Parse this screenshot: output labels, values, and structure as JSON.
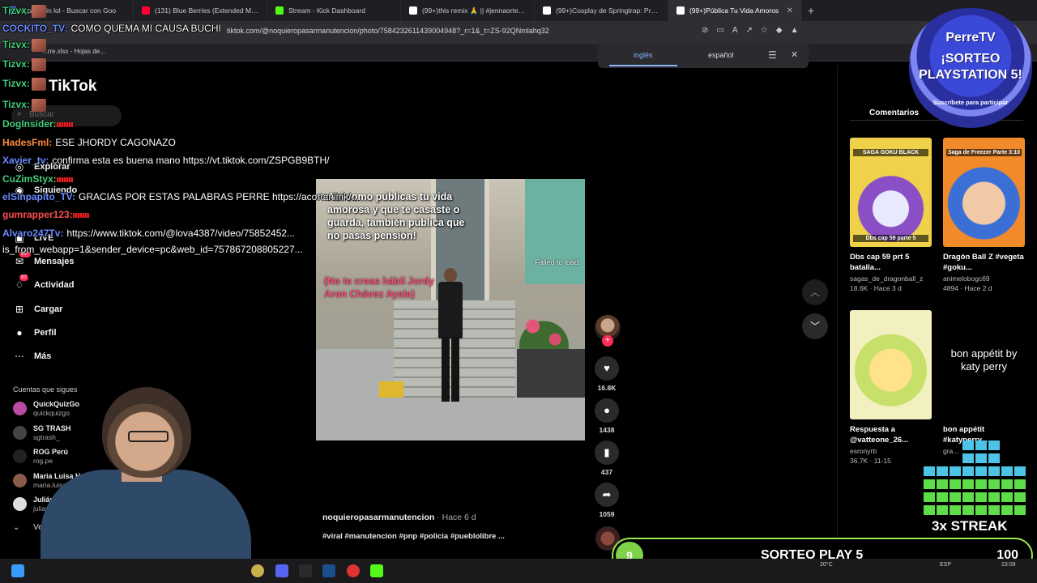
{
  "browser": {
    "tabs": [
      {
        "label": "tips to win lol - Buscar con Goo",
        "color": "#4285f4"
      },
      {
        "label": "(131) Blue Berries (Extended Mix) - Y",
        "color": "#ff0033"
      },
      {
        "label": "Stream - Kick Dashboard",
        "color": "#53fc18"
      },
      {
        "label": "(99+)this remix 🙏 || #jennaortega #j",
        "color": "#ffffff"
      },
      {
        "label": "(99+)Cosplay de Springtrap: Prueba",
        "color": "#ffffff"
      },
      {
        "label": "(99+)Pública Tu Vida Amoros",
        "color": "#ffffff"
      }
    ],
    "url": "tiktok.com/@noquieropasarmanutencion/photo/7584232611439004948?_r=1&_t=ZS-92QNmlahq32",
    "bookmark": "...rre.xlsx - Hojas de..."
  },
  "translate_bar": {
    "lang_from": "inglés",
    "lang_to": "español"
  },
  "tiktok": {
    "logo": "TikTok",
    "search_placeholder": "Buscar",
    "nav": [
      {
        "icon": "compass-icon",
        "label": "Explorar"
      },
      {
        "icon": "people-icon",
        "label": "Siguiendo"
      },
      {
        "icon": "live-icon",
        "label": "LIVE"
      },
      {
        "icon": "message-icon",
        "label": "Mensajes",
        "badge": "99+"
      },
      {
        "icon": "bell-icon",
        "label": "Actividad",
        "badge": "97"
      },
      {
        "icon": "upload-icon",
        "label": "Cargar"
      },
      {
        "icon": "profile-icon",
        "label": "Perfil"
      },
      {
        "icon": "more-icon",
        "label": "Más"
      }
    ],
    "following_header": "Cuentas que sigues",
    "following": [
      {
        "name": "QuickQuizGo",
        "handle": "quickquizgo"
      },
      {
        "name": "SG TRASH",
        "handle": "sgtrash_"
      },
      {
        "name": "ROG Perú",
        "handle": "rog.pe"
      },
      {
        "name": "Maria Luisa Hoyos",
        "handle": "maria.luisa.hoyos8"
      },
      {
        "name": "Julián Albor...",
        "handle": "julianeal..."
      }
    ],
    "see_more": "Ver..."
  },
  "video": {
    "overlay_text": "Así como públicas tu vida amorosa y que te casaste o guarda, también pública que no pasas pensión!",
    "overlay_text2": "(No te creas hábil Jordy Aron Chávez Ayala)",
    "failed": "Failed to load",
    "author": "noquieropasarmanutencion",
    "time": "· Hace 6 d",
    "tags": "#viral #manutencion #pnp #policia #pueblolibre ...",
    "likes": "16.8K",
    "comments": "1438",
    "saves": "437",
    "shares": "1059"
  },
  "right_panel": {
    "comments_tab": "Comentarios",
    "videos": [
      {
        "thumb_top": "SAGA GOKU BLACK",
        "thumb_bottom": "Dbs cap 59 parte 5",
        "title": "Dbs cap 59 prt 5 batalla...",
        "author": "sagas_de_dragonball_z",
        "views": "18.6K",
        "time": "Hace 3 d"
      },
      {
        "thumb_top": "Saga de Freezer Parte 3:10",
        "thumb_bottom": "",
        "title": "Dragón Ball Z #vegeta #goku...",
        "author": "animelobogc69",
        "views": "4894",
        "time": "Hace 2 d"
      },
      {
        "thumb_top": "",
        "thumb_bottom": "",
        "title": "Respuesta a @vatteone_26...",
        "author": "esronyrb",
        "views": "36.7K",
        "time": "11-15"
      },
      {
        "thumb_top": "bon appétit by katy perry",
        "thumb_bottom": "",
        "title": "bon appétit #katyperry...",
        "author": "gra...",
        "views": "",
        "time": ""
      }
    ]
  },
  "stream_overlay": {
    "chat": [
      {
        "user": "Tizvx:",
        "msg": "",
        "color": "#43d07a",
        "emote": true
      },
      {
        "user": "COCKITO_TV:",
        "msg": "COMO QUEMA MI CAUSA BUCHI",
        "color": "#6a8bff",
        "emote": false
      },
      {
        "user": "Tizvx:",
        "msg": "",
        "color": "#43d07a",
        "emote": true
      },
      {
        "user": "Tizvx:",
        "msg": "",
        "color": "#43d07a",
        "emote": true
      },
      {
        "user": "Tizvx:",
        "msg": "",
        "color": "#43d07a",
        "emote": true
      },
      {
        "user": "Tizvx:",
        "msg": "",
        "color": "#43d07a",
        "emote": true
      },
      {
        "user": "DogInsider:",
        "msg": "",
        "color": "#43d07a",
        "emote": false,
        "red": true
      },
      {
        "user": "HadesFml:",
        "msg": "ESE JHORDY CAGONAZO",
        "color": "#ff8a3d",
        "emote": false
      },
      {
        "user": "Xavier_tv:",
        "msg": "confirma esta es buena mano https://vt.tiktok.com/ZSPGB9BTH/",
        "color": "#6a8bff",
        "emote": false
      },
      {
        "user": "CuZimStyx:",
        "msg": "",
        "color": "#43d07a",
        "emote": false,
        "red": true
      },
      {
        "user": "elSinpapito_TV:",
        "msg": "GRACIAS POR ESTAS PALABRAS PERRE https://acortar.link/...",
        "color": "#6a8bff",
        "emote": false
      },
      {
        "user": "gumrapper123:",
        "msg": "",
        "color": "#ff4d4d",
        "emote": false,
        "red": true
      },
      {
        "user": "Alvaro247Tv:",
        "msg": "https://www.tiktok.com/@lova4387/video/75852452...",
        "color": "#6a8bff",
        "emote": false
      },
      {
        "user": "",
        "msg": "is_from_webapp=1&sender_device=pc&web_id=757867208805227...",
        "color": "#ffffff",
        "emote": false
      }
    ],
    "perretv": {
      "title": "PerreTV",
      "line1": "¡SORTEO",
      "line2": "PLAYSTATION 5!",
      "line3": "Suscríbete para participar"
    },
    "streak_label": "3x STREAK",
    "sorteo": {
      "count": "9",
      "label": "SORTEO PLAY 5",
      "goal": "100"
    }
  },
  "taskbar": {
    "weather": "20°C",
    "lang": "ESP",
    "time": "23:09"
  }
}
